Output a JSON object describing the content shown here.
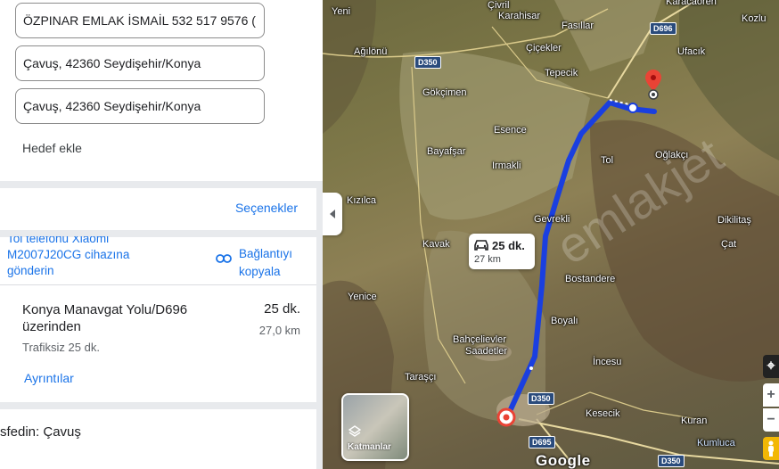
{
  "directions": {
    "origin": "ÖZPINAR EMLAK İSMAİL  532 517 9576 (",
    "stop": "Çavuş, 42360 Seydişehir/Konya",
    "destination": "Çavuş, 42360 Seydişehir/Konya",
    "add_destination": "Hedef ekle",
    "options_label": "Seçenekler",
    "send_to_phone": [
      "Tol telefonu Xiaomi",
      "M2007J20CG cihazına",
      "gönderin"
    ],
    "copy_link": [
      "Bağlantıyı",
      "kopyala"
    ]
  },
  "route": {
    "name": "Konya Manavgat Yolu/D696 üzerinden",
    "time": "25 dk.",
    "distance": "27,0 km",
    "traffic": "Trafiksiz 25 dk.",
    "details_label": "Ayrıntılar",
    "via": "sfedin: Çavuş"
  },
  "map": {
    "callout_time": "25 dk.",
    "callout_distance": "27 km",
    "layers_label": "Katmanlar",
    "brand": "Google",
    "watermark": "emlakjet",
    "places": [
      "Yeni",
      "Çivril",
      "Karahisar",
      "Fasıllar",
      "Ağılönü",
      "Çiçekler",
      "Ufacık",
      "Kozlu",
      "Karacaören",
      "Tepecik",
      "Gökçimen",
      "Esence",
      "Bayafşar",
      "Irmakli",
      "Tol",
      "Oğlakçı",
      "Kızılca",
      "Gevrekli",
      "Dikilitaş",
      "Kavak",
      "Çat",
      "Bostandere",
      "Yenice",
      "Boyalı",
      "Bahçelievler",
      "Saadetler",
      "İncesu",
      "Taraşçı",
      "Kesecik",
      "Kuran",
      "Kumluca"
    ],
    "road_shields": [
      "D696",
      "D350",
      "D350",
      "D695",
      "D350"
    ],
    "route_color": "#1a3fe0",
    "pin_color": "#ea4335"
  }
}
